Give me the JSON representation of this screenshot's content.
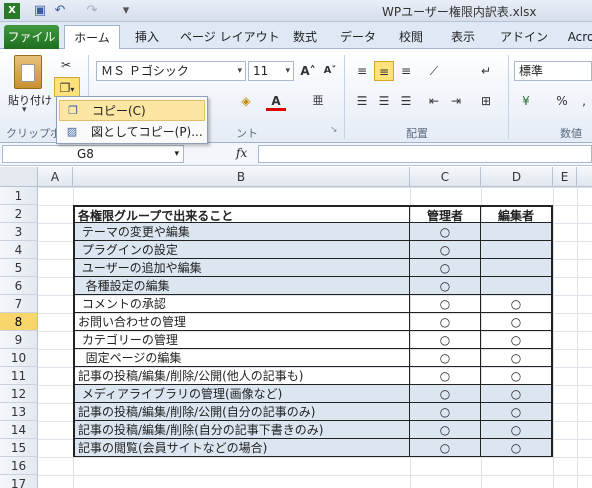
{
  "window": {
    "title": "WPユーザー権限内訳表.xlsx"
  },
  "ribbon_tabs": [
    "ファイル",
    "ホーム",
    "挿入",
    "ページ レイアウト",
    "数式",
    "データ",
    "校閲",
    "表示",
    "アドイン",
    "Acro"
  ],
  "ribbon": {
    "paste_label": "貼り付け",
    "font_name": "ＭＳ Ｐゴシック",
    "font_size": "11",
    "number_format": "標準",
    "groups": {
      "clipboard": "クリップボー",
      "font": "ント",
      "alignment": "配置",
      "number": "数値"
    }
  },
  "copy_menu": {
    "items": [
      "コピー(C)",
      "図としてコピー(P)..."
    ]
  },
  "formula_bar": {
    "name_box": "G8",
    "fx": "fx"
  },
  "sheet": {
    "columns": [
      "A",
      "B",
      "C",
      "D",
      "E"
    ],
    "rows": [
      "1",
      "2",
      "3",
      "4",
      "5",
      "6",
      "7",
      "8",
      "9",
      "10",
      "11",
      "12",
      "13",
      "14",
      "15",
      "16",
      "17"
    ],
    "selected_row": "8",
    "table": {
      "headers": [
        "各権限グループで出来ること",
        "管理者",
        "編集者"
      ],
      "rows": [
        {
          "label": " テーマの変更や編集",
          "admin": "○",
          "editor": "",
          "shaded": true
        },
        {
          "label": " プラグインの設定",
          "admin": "○",
          "editor": "",
          "shaded": true
        },
        {
          "label": " ユーザーの追加や編集",
          "admin": "○",
          "editor": "",
          "shaded": true
        },
        {
          "label": "  各種設定の編集",
          "admin": "○",
          "editor": "",
          "shaded": true
        },
        {
          "label": " コメントの承認",
          "admin": "○",
          "editor": "○",
          "shaded": false
        },
        {
          "label": "お問い合わせの管理",
          "admin": "○",
          "editor": "○",
          "shaded": false
        },
        {
          "label": " カテゴリーの管理",
          "admin": "○",
          "editor": "○",
          "shaded": false
        },
        {
          "label": "  固定ページの編集",
          "admin": "○",
          "editor": "○",
          "shaded": false
        },
        {
          "label": "記事の投稿/編集/削除/公開(他人の記事も)",
          "admin": "○",
          "editor": "○",
          "shaded": false
        },
        {
          "label": " メディアライブラリの管理(画像など)",
          "admin": "○",
          "editor": "○",
          "shaded": true
        },
        {
          "label": "記事の投稿/編集/削除/公開(自分の記事のみ)",
          "admin": "○",
          "editor": "○",
          "shaded": true
        },
        {
          "label": "記事の投稿/編集/削除(自分の記事下書きのみ)",
          "admin": "○",
          "editor": "○",
          "shaded": true
        },
        {
          "label": "記事の閲覧(会員サイトなどの場合)",
          "admin": "○",
          "editor": "○",
          "shaded": true
        }
      ]
    }
  }
}
